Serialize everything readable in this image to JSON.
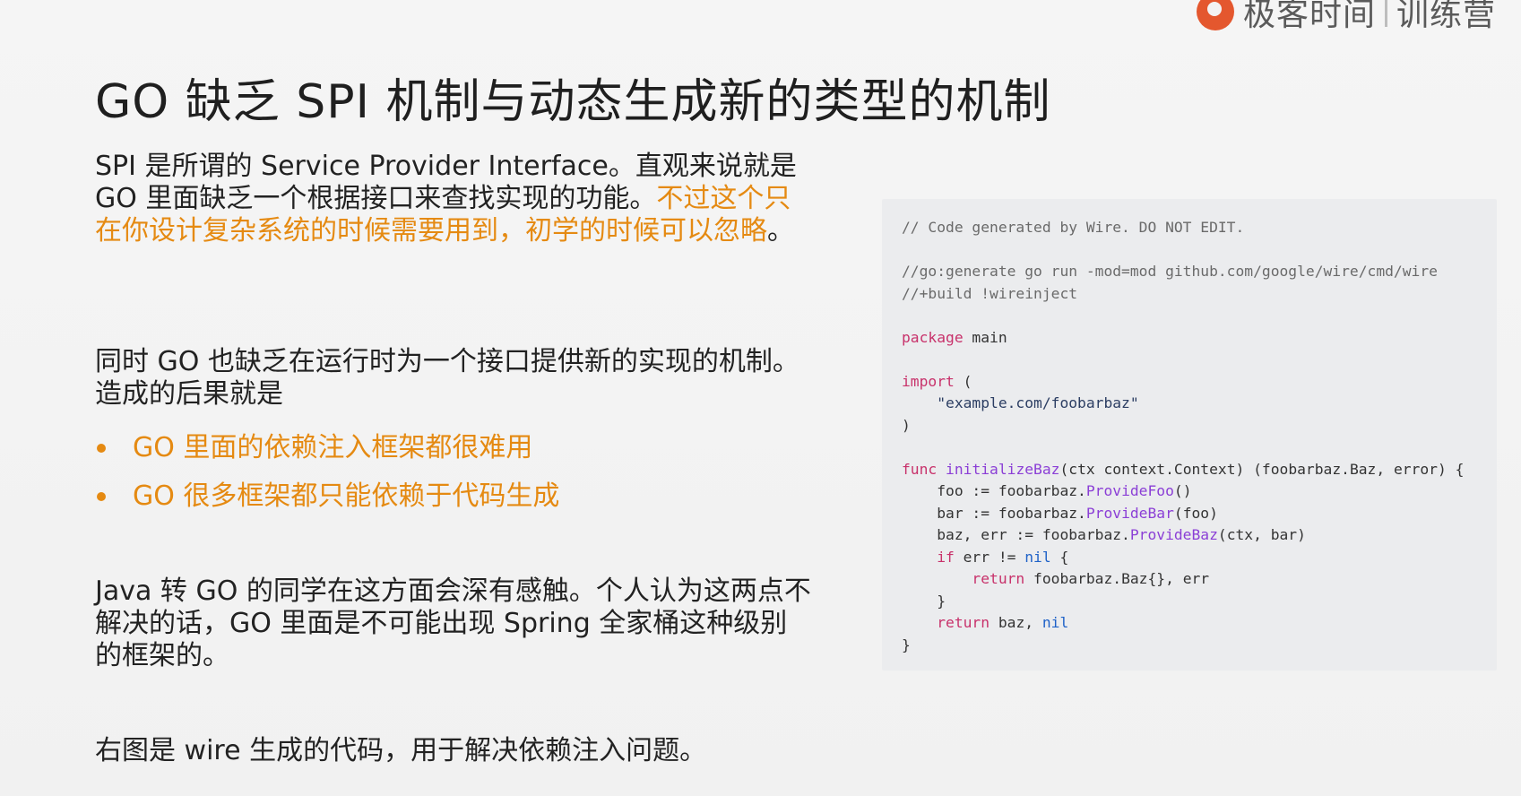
{
  "brand": {
    "name": "极客时间",
    "sub": "训练营"
  },
  "title": "GO 缺乏 SPI 机制与动态生成新的类型的机制",
  "paragraphs": {
    "p1_a": "SPI 是所谓的 Service Provider Interface。直观来说就是 GO 里面缺乏一个根据接口来查找实现的功能。",
    "p1_b": "不过这个只在你设计复杂系统的时候需要用到，初学的时候可以忽略",
    "p1_c": "。",
    "p2": "同时 GO 也缺乏在运行时为一个接口提供新的实现的机制。造成的后果就是",
    "bullets": [
      "GO 里面的依赖注入框架都很难用",
      "GO 很多框架都只能依赖于代码生成"
    ],
    "p3": "Java 转 GO 的同学在这方面会深有感触。个人认为这两点不解决的话，GO 里面是不可能出现 Spring 全家桶这种级别的框架的。",
    "p4": "右图是 wire 生成的代码，用于解决依赖注入问题。"
  },
  "code": {
    "l01": "// Code generated by Wire. DO NOT EDIT.",
    "l03": "//go:generate go run -mod=mod github.com/google/wire/cmd/wire",
    "l04": "//+build !wireinject",
    "l06_kw": "package",
    "l06_rest": " main",
    "l08_kw": "import",
    "l08_rest": " (",
    "l09": "    \"example.com/foobarbaz\"",
    "l10": ")",
    "l12_kw": "func",
    "l12_sp": " ",
    "l12_fn": "initializeBaz",
    "l12_rest": "(ctx context.Context) (foobarbaz.Baz, error) {",
    "l13_a": "    foo := foobarbaz.",
    "l13_fn": "ProvideFoo",
    "l13_b": "()",
    "l14_a": "    bar := foobarbaz.",
    "l14_fn": "ProvideBar",
    "l14_b": "(foo)",
    "l15_a": "    baz, err := foobarbaz.",
    "l15_fn": "ProvideBaz",
    "l15_b": "(ctx, bar)",
    "l16_ind": "    ",
    "l16_kw": "if",
    "l16_a": " err != ",
    "l16_nil": "nil",
    "l16_b": " {",
    "l17_ind": "        ",
    "l17_kw": "return",
    "l17_rest": " foobarbaz.Baz{}, err",
    "l18": "    }",
    "l19_ind": "    ",
    "l19_kw": "return",
    "l19_a": " baz, ",
    "l19_nil": "nil",
    "l20": "}"
  },
  "colors": {
    "highlight": "#e58a12",
    "keyword": "#c8326b",
    "function": "#8b3fd6",
    "nil": "#1f62c8"
  }
}
